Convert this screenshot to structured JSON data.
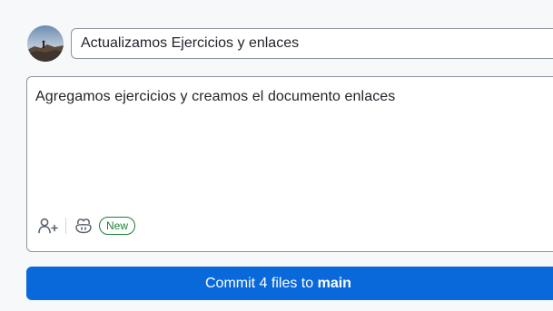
{
  "commit_form": {
    "avatar": {
      "icon": "user-avatar-photo",
      "alt": ""
    },
    "summary": {
      "value": "Actualizamos Ejercicios y enlaces",
      "placeholder": ""
    },
    "description": {
      "value": "Agregamos ejercicios y creamos el documento enlaces"
    },
    "toolbar": {
      "add_coauthor_icon": "person-add-icon",
      "copilot_icon": "copilot-icon",
      "badge": "New"
    },
    "commit_button": {
      "prefix": "Commit 4 files to ",
      "branch": "main"
    }
  },
  "colors": {
    "background": "#f6f8fa",
    "primary_button": "#0969da",
    "badge_green": "#1a7f37",
    "border": "#8c959f"
  }
}
